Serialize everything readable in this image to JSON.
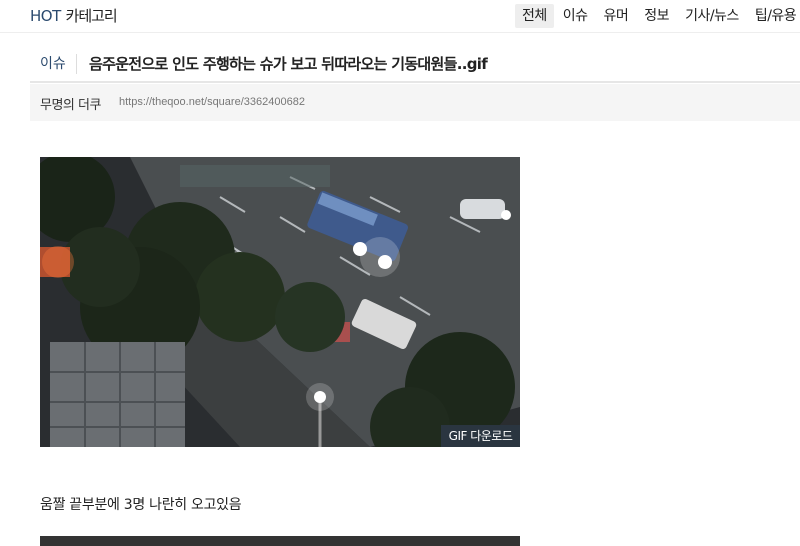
{
  "header": {
    "hot_label": "HOT",
    "category_label": "카테고리",
    "tabs": [
      {
        "label": "전체",
        "active": true
      },
      {
        "label": "이슈",
        "active": false
      },
      {
        "label": "유머",
        "active": false
      },
      {
        "label": "정보",
        "active": false
      },
      {
        "label": "기사/뉴스",
        "active": false
      },
      {
        "label": "팁/유용",
        "active": false
      }
    ]
  },
  "post": {
    "category": "이슈",
    "title": "음주운전으로 인도 주행하는 슈가 보고 뒤따라오는 기동대원들..gif",
    "author": "무명의 더쿠",
    "url": "https://theqoo.net/square/3362400682"
  },
  "media": {
    "download_label": "GIF 다운로드",
    "description_icon": "cctv-night-street-image"
  },
  "body": {
    "caption": "움짤 끝부분에 3명 나란히 오고있음"
  },
  "colors": {
    "accent": "#2b4a6e",
    "info_bar_bg": "#f5f5f5",
    "active_tab_bg": "#eeeeee"
  }
}
